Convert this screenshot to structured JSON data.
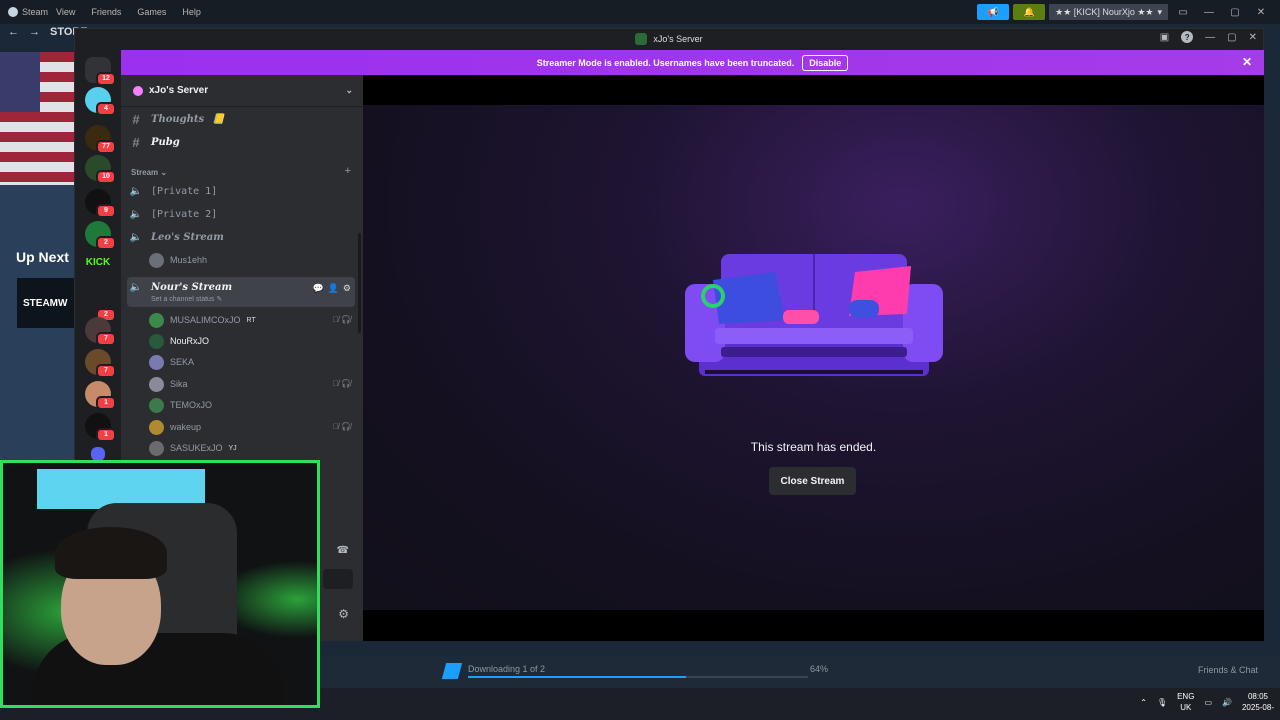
{
  "steam": {
    "menu": [
      "Steam",
      "View",
      "Friends",
      "Games",
      "Help"
    ],
    "user_label": "★★ [KICK] NourXjo ★★",
    "nav_store": "STORE",
    "up_next": "Up Next",
    "steamwb": "STEAMW",
    "download_text": "Downloading 1 of 2",
    "download_progress_pct": 64,
    "download_pct_label": "64%",
    "friends_chat": "Friends & Chat"
  },
  "discord": {
    "window_title": "xJo's Server",
    "banner_text": "Streamer Mode is enabled. Usernames have been truncated.",
    "banner_button": "Disable",
    "server_name": "xJo's Server",
    "guild_badges": [
      "12",
      "4",
      "77",
      "10",
      "9",
      "2",
      "2",
      "7",
      "7",
      "1",
      "1"
    ],
    "kick_label": "KICK",
    "channels": {
      "thoughts": "Thoughts",
      "pubg": "Pubg",
      "category": "Stream",
      "private1": "[Private 1]",
      "private2": "[Private 2]",
      "leos_stream": "Leo's Stream",
      "leo_user": "Mus1ehh",
      "nours_stream": "Nour's Stream",
      "set_status": "Set a channel status"
    },
    "users": [
      {
        "name": "MUSALIMCOxJO",
        "tag": "RT"
      },
      {
        "name": "NouRxJO",
        "tag": ""
      },
      {
        "name": "SEKA",
        "tag": ""
      },
      {
        "name": "Sika",
        "tag": ""
      },
      {
        "name": "TEMOxJO",
        "tag": ""
      },
      {
        "name": "wakeup",
        "tag": ""
      },
      {
        "name": "SASUKExJO",
        "tag": "YJ"
      }
    ],
    "stream_ended_text": "This stream has ended.",
    "close_stream": "Close Stream"
  },
  "taskbar": {
    "lang_top": "ENG",
    "lang_bottom": "UK",
    "time": "08:05",
    "date": "2025-08-"
  },
  "colors": {
    "banner": "#a335ee",
    "webcam_border": "#2ee05b",
    "kick": "#53fc18",
    "badge": "#f23f43"
  }
}
